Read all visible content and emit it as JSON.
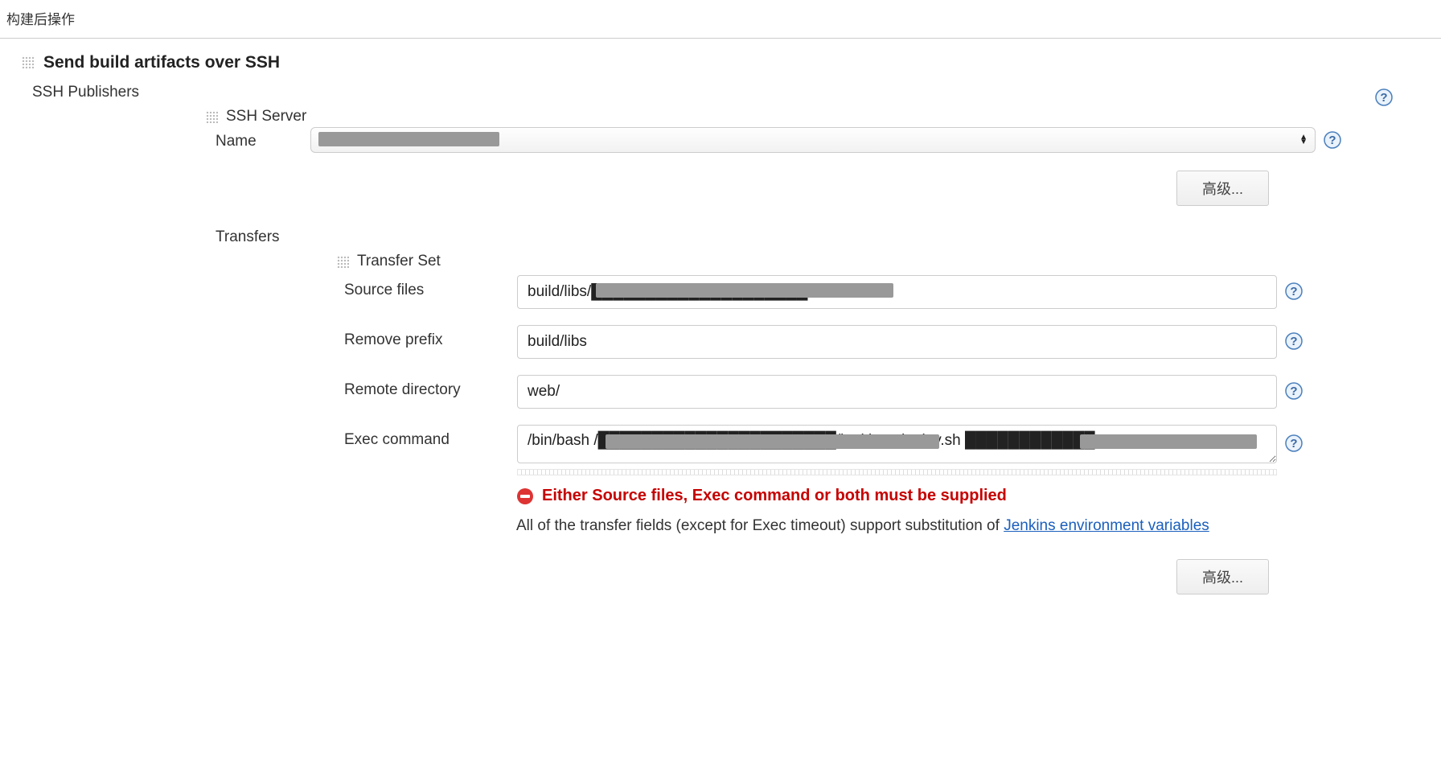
{
  "section": {
    "title": "构建后操作"
  },
  "block": {
    "title": "Send build artifacts over SSH",
    "publishers_label": "SSH Publishers",
    "ssh_server_label": "SSH Server",
    "name_label": "Name",
    "name_value": "",
    "advanced_label": "高级...",
    "transfers_label": "Transfers",
    "transfer_set_label": "Transfer Set",
    "fields": {
      "source_files": {
        "label": "Source files",
        "value": "build/libs/████████████████████.war"
      },
      "remove_prefix": {
        "label": "Remove prefix",
        "value": "build/libs"
      },
      "remote_directory": {
        "label": "Remote directory",
        "value": "web/"
      },
      "exec_command": {
        "label": "Exec command",
        "value": "/bin/bash /██████████████████████/jenkins_deploy.sh ████████████"
      }
    },
    "error": "Either Source files, Exec command or both must be supplied",
    "info_prefix": "All of the transfer fields (except for Exec timeout) support substitution of ",
    "info_link": "Jenkins environment variables"
  }
}
